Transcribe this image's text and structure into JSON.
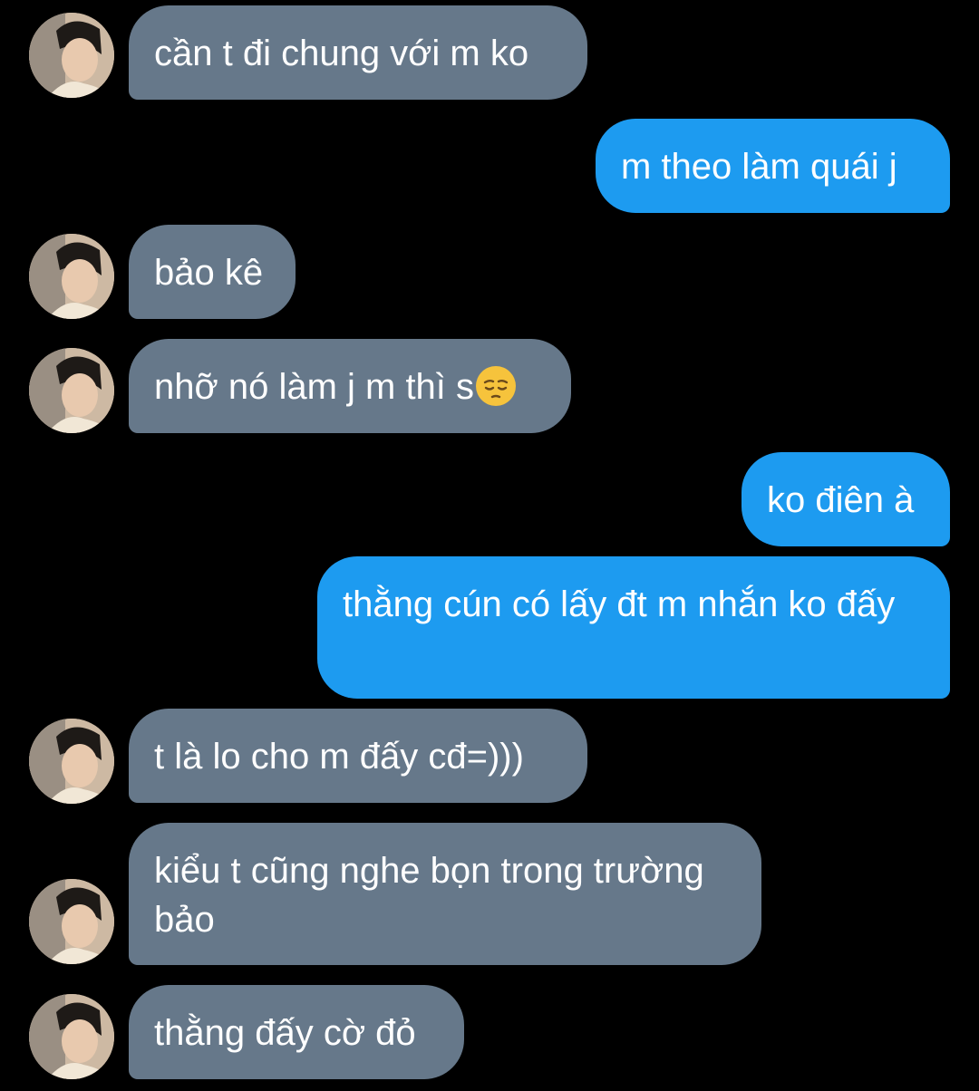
{
  "conversation": {
    "messages": [
      {
        "side": "incoming",
        "text": "cần t đi chung với m ko"
      },
      {
        "side": "outgoing",
        "text": "m theo làm quái j"
      },
      {
        "side": "incoming",
        "text": "bảo kê"
      },
      {
        "side": "incoming",
        "text": "nhỡ nó làm j m thì s",
        "emoji": "pensive-face"
      },
      {
        "side": "outgoing",
        "text": "ko điên à"
      },
      {
        "side": "outgoing",
        "text": "thằng cún có lấy đt m nhắn ko đấy"
      },
      {
        "side": "incoming",
        "text": "t là lo cho m đấy cđ=)))"
      },
      {
        "side": "incoming",
        "text": "kiểu t cũng nghe bọn trong trường bảo"
      },
      {
        "side": "incoming",
        "text": "thằng đấy cờ đỏ"
      }
    ]
  },
  "colors": {
    "background": "#000000",
    "incoming_bubble": "#66788a",
    "outgoing_bubble": "#1d9bf0",
    "text": "#ffffff"
  },
  "icons": {
    "avatar": "contact-avatar-photo",
    "emoji": "pensive-face"
  }
}
